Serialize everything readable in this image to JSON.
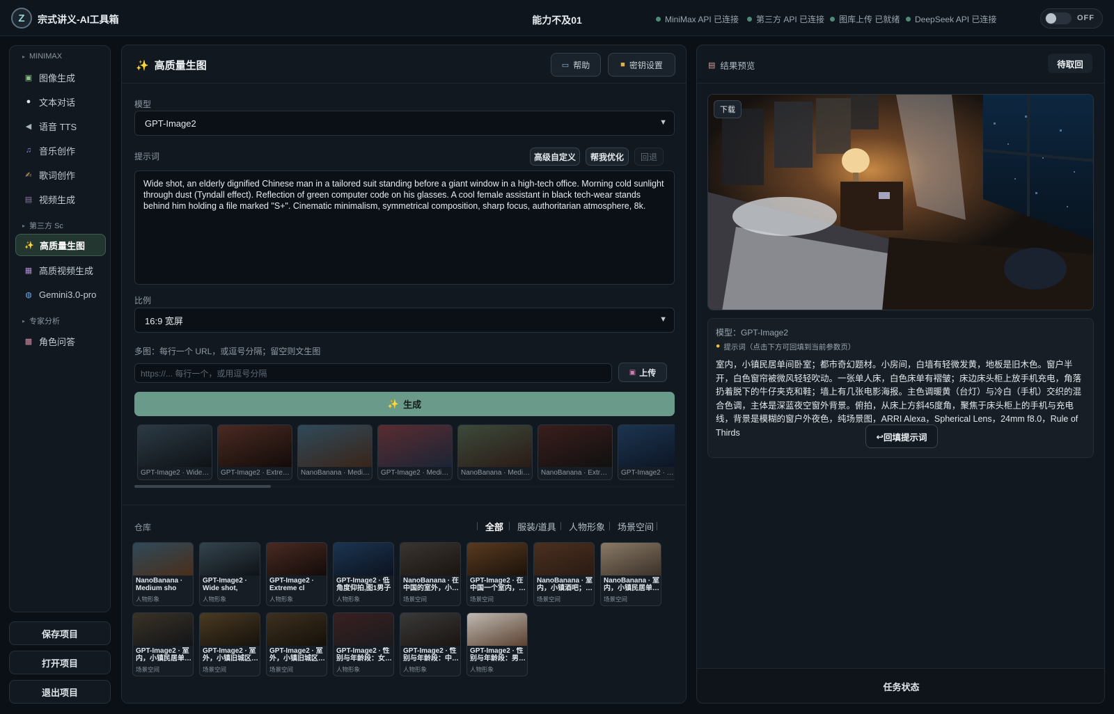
{
  "header": {
    "logo_letter": "Z",
    "app_title": "宗式讲义-AI工具箱",
    "center_title": "能力不及01",
    "statuses": [
      {
        "label": "MiniMax API 已连接"
      },
      {
        "label": "第三方 API 已连接"
      },
      {
        "label": "图库上传 已就绪"
      },
      {
        "label": "DeepSeek API 已连接"
      }
    ],
    "toggle_label": "OFF"
  },
  "sidebar": {
    "sections": [
      "MINIMAX",
      "第三方 Sc",
      "专家分析"
    ],
    "items": [
      {
        "label": "图像生成",
        "icon": "image-icon",
        "glyph": "▣"
      },
      {
        "label": "文本对话",
        "icon": "chat-bubble-icon",
        "glyph": "●"
      },
      {
        "label": "语音 TTS",
        "icon": "speaker-icon",
        "glyph": "◀"
      },
      {
        "label": "音乐创作",
        "icon": "music-note-icon",
        "glyph": "♫"
      },
      {
        "label": "歌词创作",
        "icon": "writing-hand-icon",
        "glyph": "✍"
      },
      {
        "label": "视频生成",
        "icon": "video-icon",
        "glyph": "▤"
      },
      {
        "label": "高质量生图",
        "icon": "sparkles-icon",
        "glyph": "✨"
      },
      {
        "label": "高质视频生成",
        "icon": "clapper-icon",
        "glyph": "▦"
      },
      {
        "label": "Gemini3.0-pro",
        "icon": "globe-icon",
        "glyph": "◍"
      },
      {
        "label": "角色问答",
        "icon": "robot-icon",
        "glyph": "▩"
      }
    ],
    "buttons": {
      "save": "保存项目",
      "open": "打开项目",
      "exit": "退出项目"
    }
  },
  "main": {
    "title": "高质量生图",
    "title_icon": "✨",
    "help_label": "帮助",
    "key_settings_label": "密钥设置",
    "model_label": "模型",
    "model_value": "GPT-Image2",
    "prompt_label": "提示词",
    "advanced_label": "高级自定义",
    "optimize_label": "帮我优化",
    "revert_label": "回退",
    "prompt_text": "Wide shot, an elderly dignified Chinese man in a tailored suit standing before a giant window in a high-tech office. Morning cold sunlight through dust (Tyndall effect). Reflection of green computer code on his glasses. A cool female assistant in black tech-wear stands behind him holding a file marked \"S+\". Cinematic minimalism, symmetrical composition, sharp focus, authoritarian atmosphere, 8k.",
    "ratio_label": "比例",
    "ratio_value": "16:9 宽屏",
    "multi_label": "多图：每行一个 URL，或逗号分隔；留空则文生图",
    "url_placeholder": "https://... 每行一个，或用逗号分隔",
    "upload_label": "上传",
    "generate_label": "生成",
    "history": [
      {
        "caption": "GPT-Image2 · Wide s…",
        "colors": [
          "#2c3a44",
          "#0e1216"
        ]
      },
      {
        "caption": "GPT-Image2 · Extrem…",
        "colors": [
          "#4a2a22",
          "#120b09"
        ]
      },
      {
        "caption": "NanoBanana · Mediu…",
        "colors": [
          "#2f4a5a",
          "#3a2418"
        ]
      },
      {
        "caption": "GPT-Image2 · Mediu…",
        "colors": [
          "#5a2c30",
          "#1b2436"
        ]
      },
      {
        "caption": "NanoBanana · Mediu…",
        "colors": [
          "#3d4a3a",
          "#2a1b16"
        ]
      },
      {
        "caption": "NanoBanana · Extre…",
        "colors": [
          "#3a1e1c",
          "#101010"
        ]
      },
      {
        "caption": "GPT-Image2 · …",
        "colors": [
          "#1c3550",
          "#0b1220"
        ]
      }
    ],
    "repo_label": "仓库",
    "repo_tabs": [
      "全部",
      "服装/道具",
      "人物形象",
      "场景空间"
    ],
    "repo": [
      {
        "title": "NanoBanana · Medium sho",
        "cat": "人物形象",
        "colors": [
          "#2f4a5a",
          "#4a2e1a"
        ]
      },
      {
        "title": "GPT-Image2 · Wide shot,",
        "cat": "人物形象",
        "colors": [
          "#34444e",
          "#0e1216"
        ]
      },
      {
        "title": "GPT-Image2 · Extreme cl",
        "cat": "人物形象",
        "colors": [
          "#4a2a22",
          "#120b09"
        ]
      },
      {
        "title": "GPT-Image2 · 低角度仰拍,图1男子",
        "cat": "人物形象",
        "colors": [
          "#1c3550",
          "#0b1220"
        ]
      },
      {
        "title": "NanoBanana · 在中国的室外，小…",
        "cat": "场景空间",
        "colors": [
          "#3a3530",
          "#1a1410"
        ]
      },
      {
        "title": "GPT-Image2 · 在中国一个室内，…",
        "cat": "场景空间",
        "colors": [
          "#5a3a20",
          "#1a120a"
        ]
      },
      {
        "title": "NanoBanana · 室内，小镇酒吧；…",
        "cat": "场景空间",
        "colors": [
          "#4a3020",
          "#2a1a12"
        ]
      },
      {
        "title": "NanoBanana · 室内，小镇民居单…",
        "cat": "场景空间",
        "colors": [
          "#8a7a66",
          "#3a3028"
        ]
      },
      {
        "title": "GPT-Image2 · 室内，小镇民居单…",
        "cat": "场景空间",
        "colors": [
          "#3a3226",
          "#121418"
        ]
      },
      {
        "title": "GPT-Image2 · 室外，小镇旧城区…",
        "cat": "场景空间",
        "colors": [
          "#4a3a22",
          "#15110b"
        ]
      },
      {
        "title": "GPT-Image2 · 室外，小镇旧城区…",
        "cat": "场景空间",
        "colors": [
          "#3e3020",
          "#141008"
        ]
      },
      {
        "title": "GPT-Image2 · 性别与年龄段：女…",
        "cat": "人物形象",
        "colors": [
          "#3a2020",
          "#1a1a1e"
        ]
      },
      {
        "title": "GPT-Image2 · 性别与年龄段：中…",
        "cat": "人物形象",
        "colors": [
          "#3a3a3a",
          "#1a1410"
        ]
      },
      {
        "title": "GPT-Image2 · 性别与年龄段：男…",
        "cat": "人物形象",
        "colors": [
          "#c0bab2",
          "#5a4030"
        ]
      }
    ]
  },
  "result": {
    "title": "结果预览",
    "pending_label": "待取回",
    "download_label": "下载",
    "model_line": "模型：GPT-Image2",
    "prompt_hint": "提示词（点击下方可回填到当前参数页）",
    "prompt_text": "室内，小镇民居单间卧室；都市奇幻题材。小房间，白墙有轻微发黄，地板是旧木色。窗户半开，白色窗帘被微风轻轻吹动。一张单人床，白色床单有褶皱；床边床头柜上放手机充电，角落扔着脱下的牛仔夹克和鞋；墙上有几张电影海报。主色调暖黄（台灯）与冷白（手机）交织的混合色调，主体是深蓝夜空窗外背景。俯拍，从床上方斜45度角，聚焦于床头柜上的手机与充电线，背景是模糊的窗户外夜色，纯场景图，ARRI Alexa，Spherical Lens，24mm f8.0，Rule of Thirds",
    "backfill_label": "回填提示词",
    "task_status_label": "任务状态"
  }
}
